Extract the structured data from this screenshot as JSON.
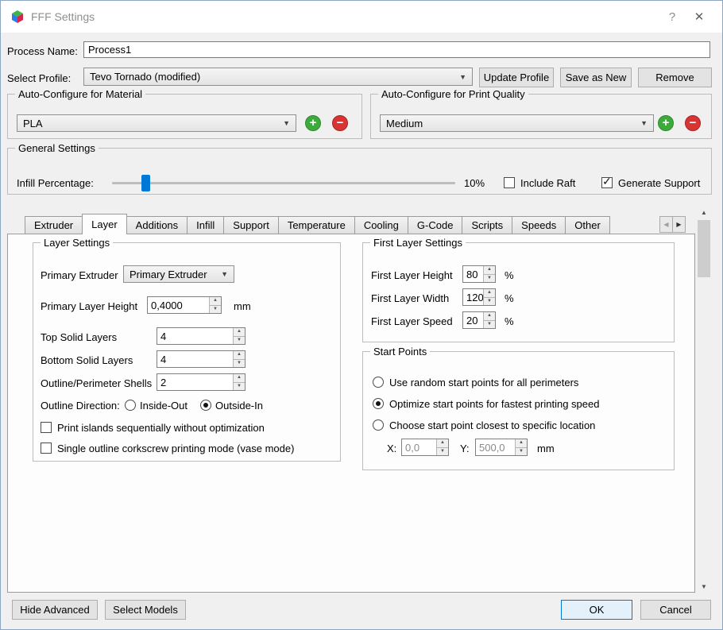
{
  "colors": {
    "accent": "#0078d7",
    "add_green": "#3cab3c",
    "remove_red": "#d83434"
  },
  "window": {
    "title": "FFF Settings",
    "help": "?",
    "close": "✕"
  },
  "header": {
    "process_name_label": "Process Name:",
    "process_name_value": "Process1",
    "select_profile_label": "Select Profile:",
    "profile_value": "Tevo Tornado (modified)",
    "buttons": {
      "update": "Update Profile",
      "save_as_new": "Save as New",
      "remove": "Remove"
    }
  },
  "auto_material": {
    "title": "Auto-Configure for Material",
    "value": "PLA"
  },
  "auto_quality": {
    "title": "Auto-Configure for Print Quality",
    "value": "Medium"
  },
  "general": {
    "title": "General Settings",
    "infill_label": "Infill Percentage:",
    "infill_value": "10%",
    "include_raft_label": "Include Raft",
    "generate_support_label": "Generate Support"
  },
  "tabs": {
    "active": "Layer",
    "items": [
      {
        "label": "Extruder"
      },
      {
        "label": "Layer"
      },
      {
        "label": "Additions"
      },
      {
        "label": "Infill"
      },
      {
        "label": "Support"
      },
      {
        "label": "Temperature"
      },
      {
        "label": "Cooling"
      },
      {
        "label": "G-Code"
      },
      {
        "label": "Scripts"
      },
      {
        "label": "Speeds"
      },
      {
        "label": "Other"
      }
    ]
  },
  "layer_settings": {
    "title": "Layer Settings",
    "primary_extruder_label": "Primary Extruder",
    "primary_extruder_value": "Primary Extruder",
    "primary_layer_height_label": "Primary Layer Height",
    "primary_layer_height_value": "0,4000",
    "primary_layer_height_unit": "mm",
    "top_solid_label": "Top Solid Layers",
    "top_solid_value": "4",
    "bottom_solid_label": "Bottom Solid Layers",
    "bottom_solid_value": "4",
    "shells_label": "Outline/Perimeter Shells",
    "shells_value": "2",
    "outline_direction_label": "Outline Direction:",
    "inside_out_label": "Inside-Out",
    "outside_in_label": "Outside-In",
    "print_islands_label": "Print islands sequentially without optimization",
    "vase_mode_label": "Single outline corkscrew printing mode (vase mode)"
  },
  "first_layer": {
    "title": "First Layer Settings",
    "height_label": "First Layer Height",
    "height_value": "80",
    "width_label": "First Layer Width",
    "width_value": "120",
    "speed_label": "First Layer Speed",
    "speed_value": "20",
    "unit": "%"
  },
  "start_points": {
    "title": "Start Points",
    "random_label": "Use random start points for all perimeters",
    "optimize_label": "Optimize start points for fastest printing speed",
    "closest_label": "Choose start point closest to specific location",
    "x_label": "X:",
    "x_value": "0,0",
    "y_label": "Y:",
    "y_value": "500,0",
    "unit": "mm"
  },
  "footer": {
    "hide_advanced": "Hide Advanced",
    "select_models": "Select Models",
    "ok": "OK",
    "cancel": "Cancel"
  }
}
